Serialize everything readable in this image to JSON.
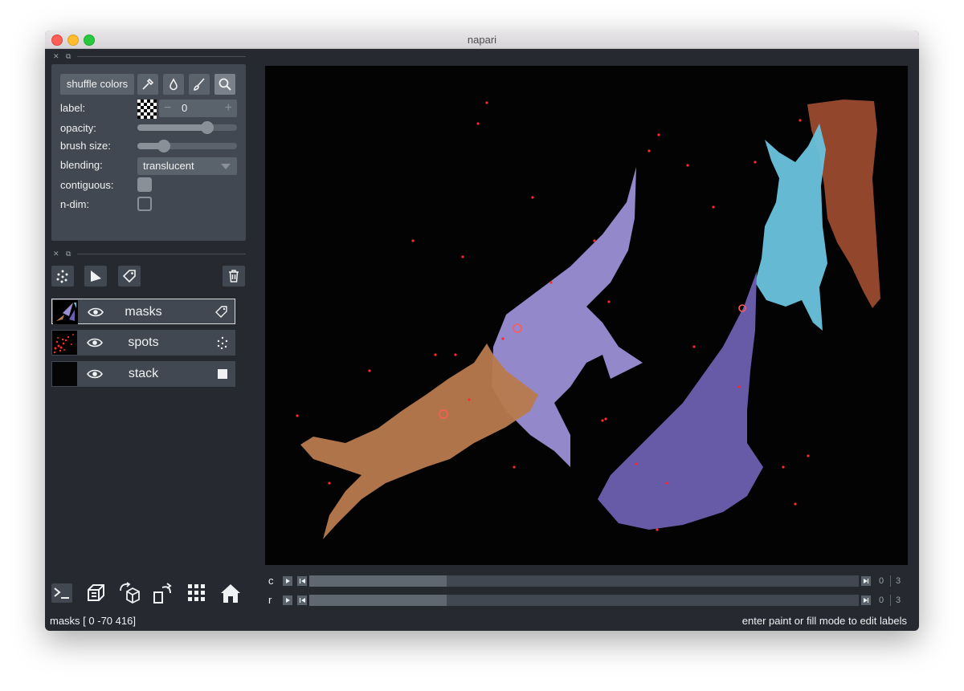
{
  "window": {
    "title": "napari"
  },
  "layer_controls": {
    "shuffle_label": "shuffle colors",
    "tools": [
      "picker-icon",
      "fill-icon",
      "paint-icon",
      "zoom-icon"
    ],
    "label_label": "label:",
    "label_value": "0",
    "opacity_label": "opacity:",
    "opacity_value": 0.7,
    "brush_size_label": "brush size:",
    "brush_size_value": 0.27,
    "blending_label": "blending:",
    "blending_value": "translucent",
    "contiguous_label": "contiguous:",
    "contiguous_checked": true,
    "ndim_label": "n-dim:",
    "ndim_checked": false
  },
  "layer_buttons": [
    "new-points-icon",
    "new-shapes-icon",
    "new-labels-icon",
    "delete-layer-icon"
  ],
  "layers": [
    {
      "name": "masks",
      "type_icon": "labels-icon",
      "visible": true,
      "selected": true
    },
    {
      "name": "spots",
      "type_icon": "points-icon",
      "visible": true,
      "selected": false
    },
    {
      "name": "stack",
      "type_icon": "image-icon",
      "visible": true,
      "selected": false
    }
  ],
  "dims": [
    {
      "label": "c",
      "current": "0",
      "total": "3",
      "position": 0.25
    },
    {
      "label": "r",
      "current": "0",
      "total": "3",
      "position": 0.25
    }
  ],
  "viewer_buttons": [
    "console-icon",
    "ndisplay-icon",
    "roll-dims-icon",
    "transpose-icon",
    "grid-icon",
    "home-icon"
  ],
  "status": {
    "left": "masks [  0 -70 416]",
    "right": "enter paint or fill mode to edit labels"
  },
  "colors": {
    "cell_orange": "#b87a4e",
    "cell_lavender": "#9b8fd4",
    "cell_purple": "#6d5fb0",
    "cell_cyan": "#6cc3dd",
    "cell_brown": "#9a4a2e",
    "spots": "#ff2a2a"
  }
}
